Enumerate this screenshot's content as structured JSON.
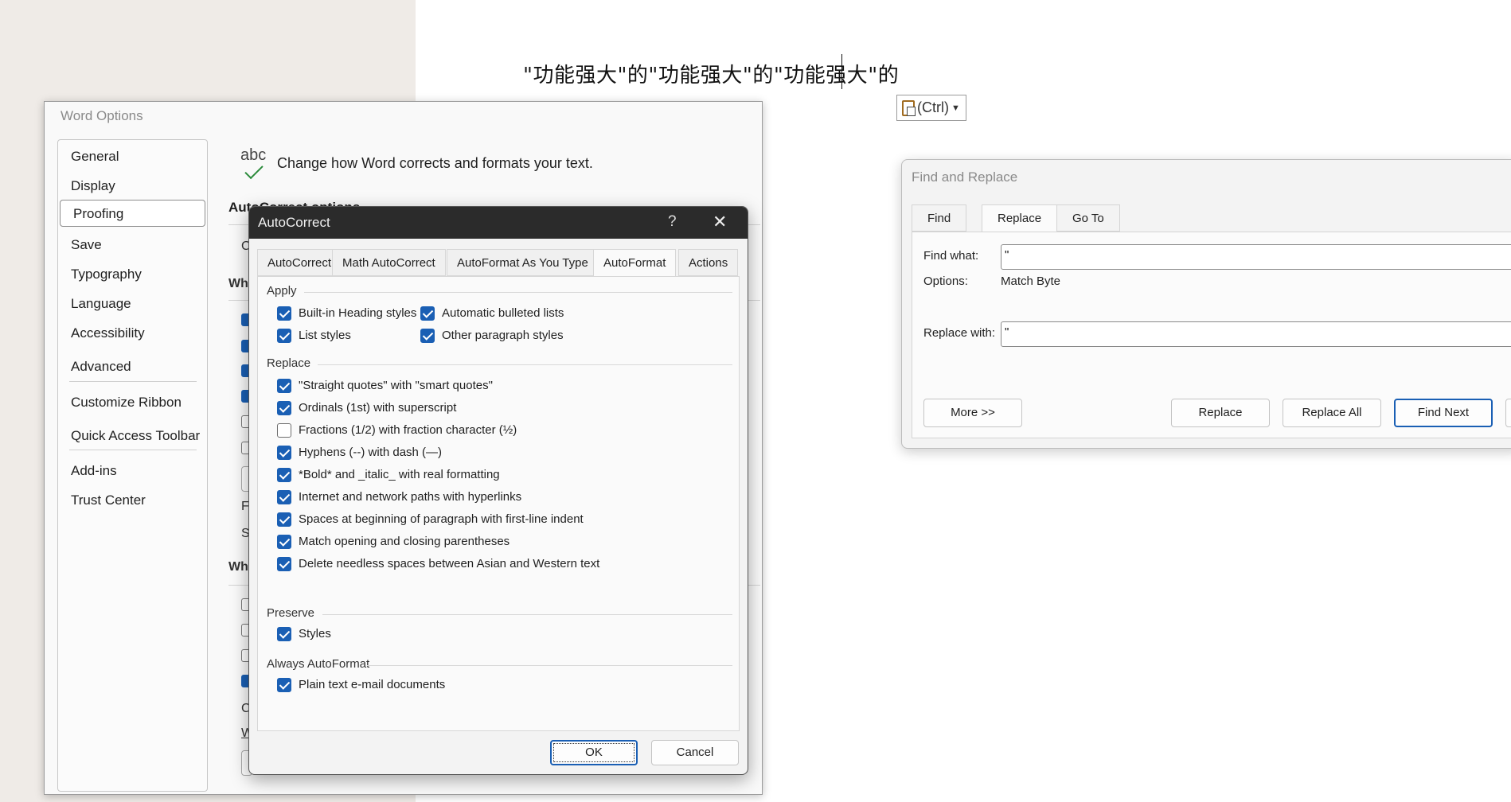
{
  "document": {
    "text": "\"功能强大\"的\"功能强大\"的\"功能强大\"的",
    "paste_options_label": "(Ctrl)"
  },
  "word_options": {
    "title": "Word Options",
    "nav": [
      "General",
      "Display",
      "Proofing",
      "Save",
      "Typography",
      "Language",
      "Accessibility",
      "Advanced",
      "Customize Ribbon",
      "Quick Access Toolbar",
      "Add-ins",
      "Trust Center"
    ],
    "selected_nav": "Proofing",
    "icon_text": "abc",
    "heading": "Change how Word corrects and formats your text.",
    "section_autocorrect": "AutoCorrect options",
    "fragments": {
      "c": "C",
      "wh1": "Wh",
      "f": "F",
      "s": "S",
      "wh2": "Wh",
      "c2": "C",
      "w": "W"
    }
  },
  "autocorrect": {
    "title": "AutoCorrect",
    "help_glyph": "?",
    "close_glyph": "✕",
    "tabs": [
      "AutoCorrect",
      "Math AutoCorrect",
      "AutoFormat As You Type",
      "AutoFormat",
      "Actions"
    ],
    "selected_tab": "AutoFormat",
    "groups": {
      "apply": "Apply",
      "replace": "Replace",
      "preserve": "Preserve",
      "always": "Always AutoFormat"
    },
    "apply_items": [
      {
        "label": "Built-in Heading styles",
        "checked": true
      },
      {
        "label": "Automatic bulleted lists",
        "checked": true
      },
      {
        "label": "List styles",
        "checked": true
      },
      {
        "label": "Other paragraph styles",
        "checked": true
      }
    ],
    "replace_items": [
      {
        "label": "\"Straight quotes\" with \"smart quotes\"",
        "checked": true
      },
      {
        "label": "Ordinals (1st) with superscript",
        "checked": true
      },
      {
        "label": "Fractions (1/2) with fraction character (½)",
        "checked": false
      },
      {
        "label": "Hyphens (--) with dash (—)",
        "checked": true
      },
      {
        "label": "*Bold* and _italic_ with real formatting",
        "checked": true
      },
      {
        "label": "Internet and network paths with hyperlinks",
        "checked": true
      },
      {
        "label": "Spaces at beginning of paragraph with first-line indent",
        "checked": true
      },
      {
        "label": "Match opening and closing parentheses",
        "checked": true
      },
      {
        "label": "Delete needless spaces between Asian and Western text",
        "checked": true
      }
    ],
    "preserve_items": [
      {
        "label": "Styles",
        "checked": true
      }
    ],
    "always_items": [
      {
        "label": "Plain text e-mail documents",
        "checked": true
      }
    ],
    "ok_label": "OK",
    "cancel_label": "Cancel"
  },
  "find_replace": {
    "title": "Find and Replace",
    "tabs": [
      "Find",
      "Replace",
      "Go To"
    ],
    "selected_tab": "Replace",
    "find_what_label": "Find what:",
    "find_what_value": "\"",
    "options_label": "Options:",
    "options_value": "Match Byte",
    "replace_with_label": "Replace with:",
    "replace_with_value": "\"",
    "more_label": "More >>",
    "replace_label": "Replace",
    "replace_all_label": "Replace All",
    "find_next_label": "Find Next"
  },
  "colors": {
    "accent": "#1a5fb4",
    "title_bar": "#2b2b2b",
    "checkmark": "#2a8a3a"
  }
}
